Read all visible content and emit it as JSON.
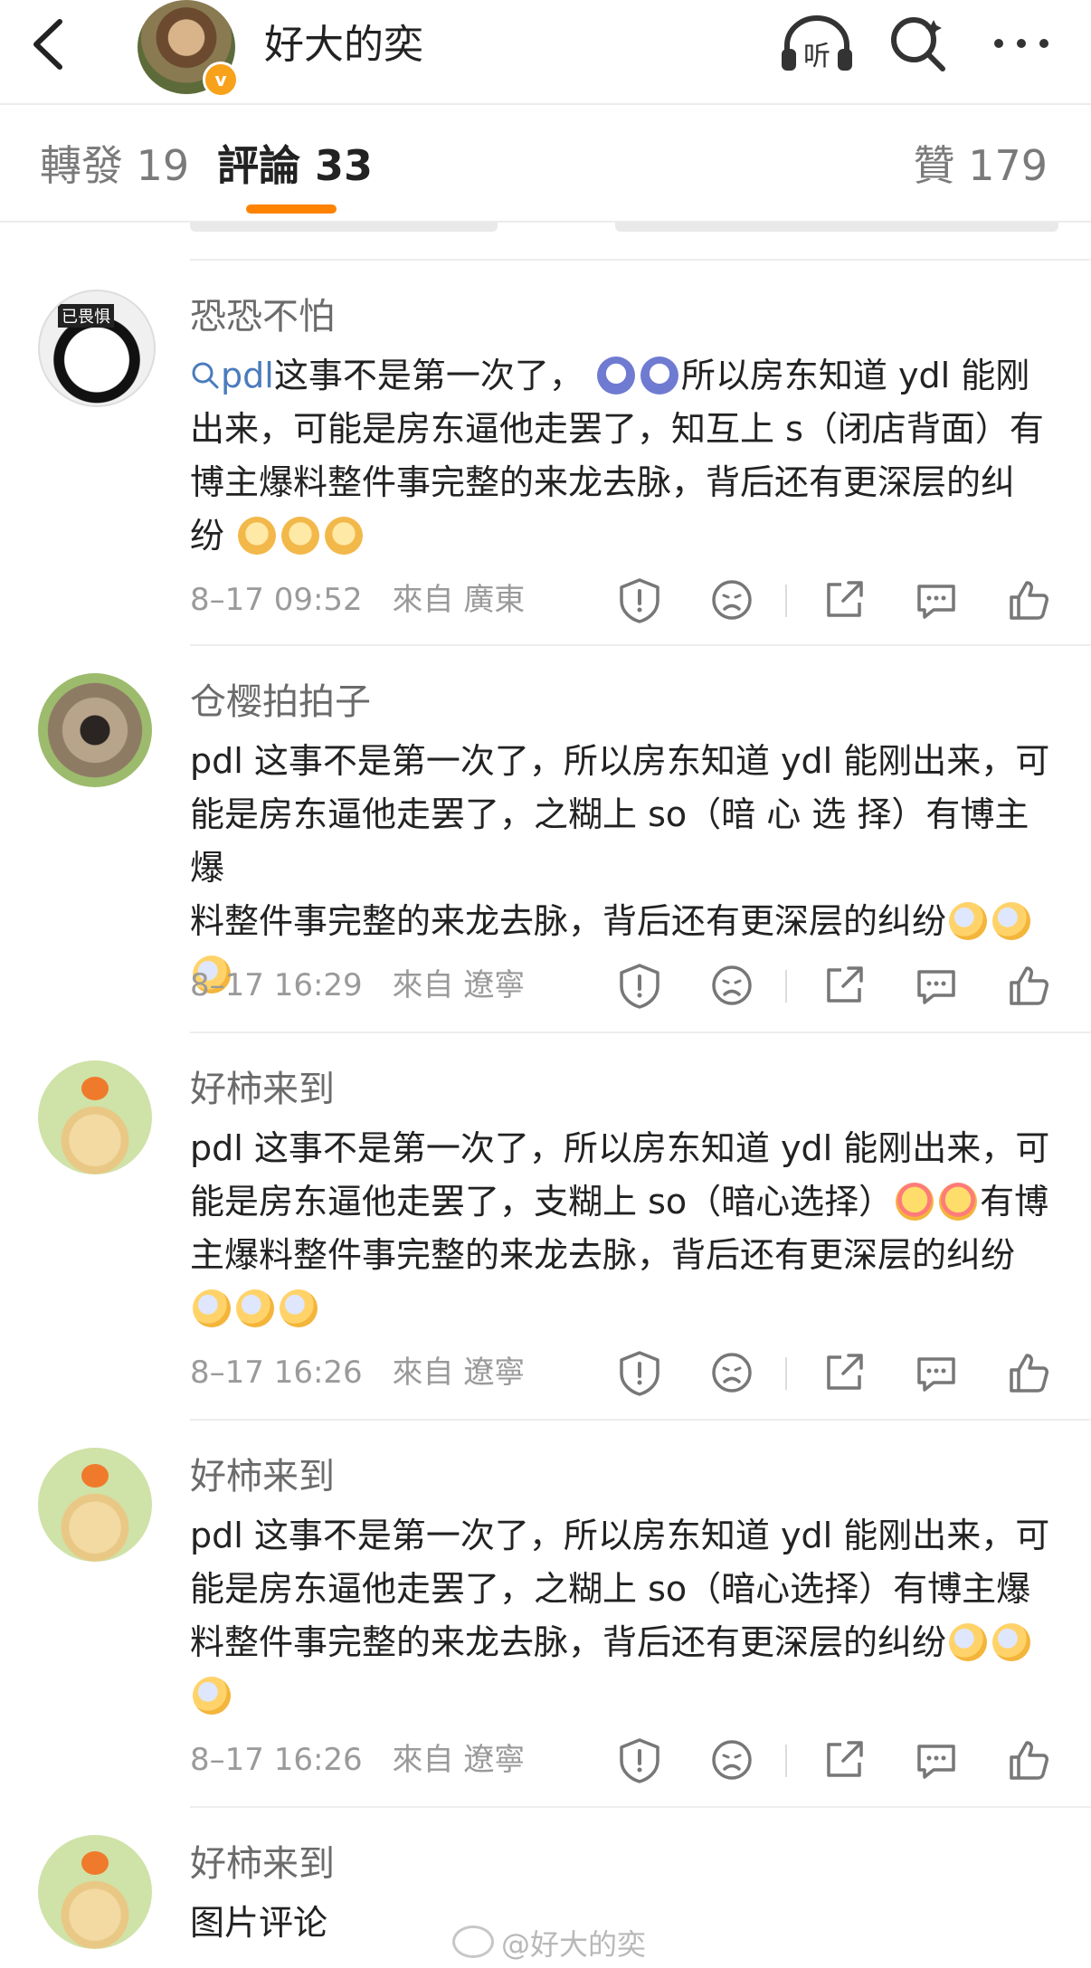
{
  "header": {
    "title": "好大的奕",
    "badge": "v",
    "icons": [
      "back-icon",
      "listen-icon",
      "search-icon",
      "more-icon"
    ],
    "listen_label": "听"
  },
  "tabs": {
    "repost": "轉發 19",
    "comments": "評論 33",
    "likes": "贊 179",
    "active_color": "#ff8200"
  },
  "comments": [
    {
      "name": "恐恐不怕",
      "avatar_label": "已畏惧",
      "mention": "pdl",
      "text_lines": [
        "这事不是第一次了，",
        "所以房东知道 ydl 能刚",
        "出来，可能是房东逼他走罢了，知互上 s（闭店背面）有",
        "博主爆料整件事完整的来龙去脉，背后还有更深层的纠",
        "纷"
      ],
      "time": "8–17 09:52",
      "from": "來自",
      "location": "廣東"
    },
    {
      "name": "仓樱拍拍子",
      "text_lines": [
        "pdl 这事不是第一次了，所以房东知道 ydl 能刚出来，可",
        "能是房东逼他走罢了，之糊上 so（暗 心 选 择）有博主爆",
        "料整件事完整的来龙去脉，背后还有更深层的纠纷"
      ],
      "time": "8–17 16:29",
      "from": "來自",
      "location": "遼寧"
    },
    {
      "name": "好柿来到",
      "text_lines": [
        "pdl 这事不是第一次了，所以房东知道 ydl 能刚出来，可",
        "能是房东逼他走罢了，支糊上 so（暗心选择）",
        "有博",
        "主爆料整件事完整的来龙去脉，背后还有更深层的纠纷"
      ],
      "time": "8–17 16:26",
      "from": "來自",
      "location": "遼寧"
    },
    {
      "name": "好柿来到",
      "text_lines": [
        "pdl 这事不是第一次了，所以房东知道 ydl 能刚出来，可",
        "能是房东逼他走罢了，之糊上 so（暗心选择）有博主爆",
        "料整件事完整的来龙去脉，背后还有更深层的纠纷"
      ],
      "time": "8–17 16:26",
      "from": "來自",
      "location": "遼寧"
    },
    {
      "name": "好柿来到",
      "text_lines": [
        "图片评论"
      ]
    }
  ],
  "action_icons": [
    "report-icon",
    "dislike-icon",
    "share-icon",
    "reply-icon",
    "like-icon"
  ],
  "watermark": "@好大的奕"
}
